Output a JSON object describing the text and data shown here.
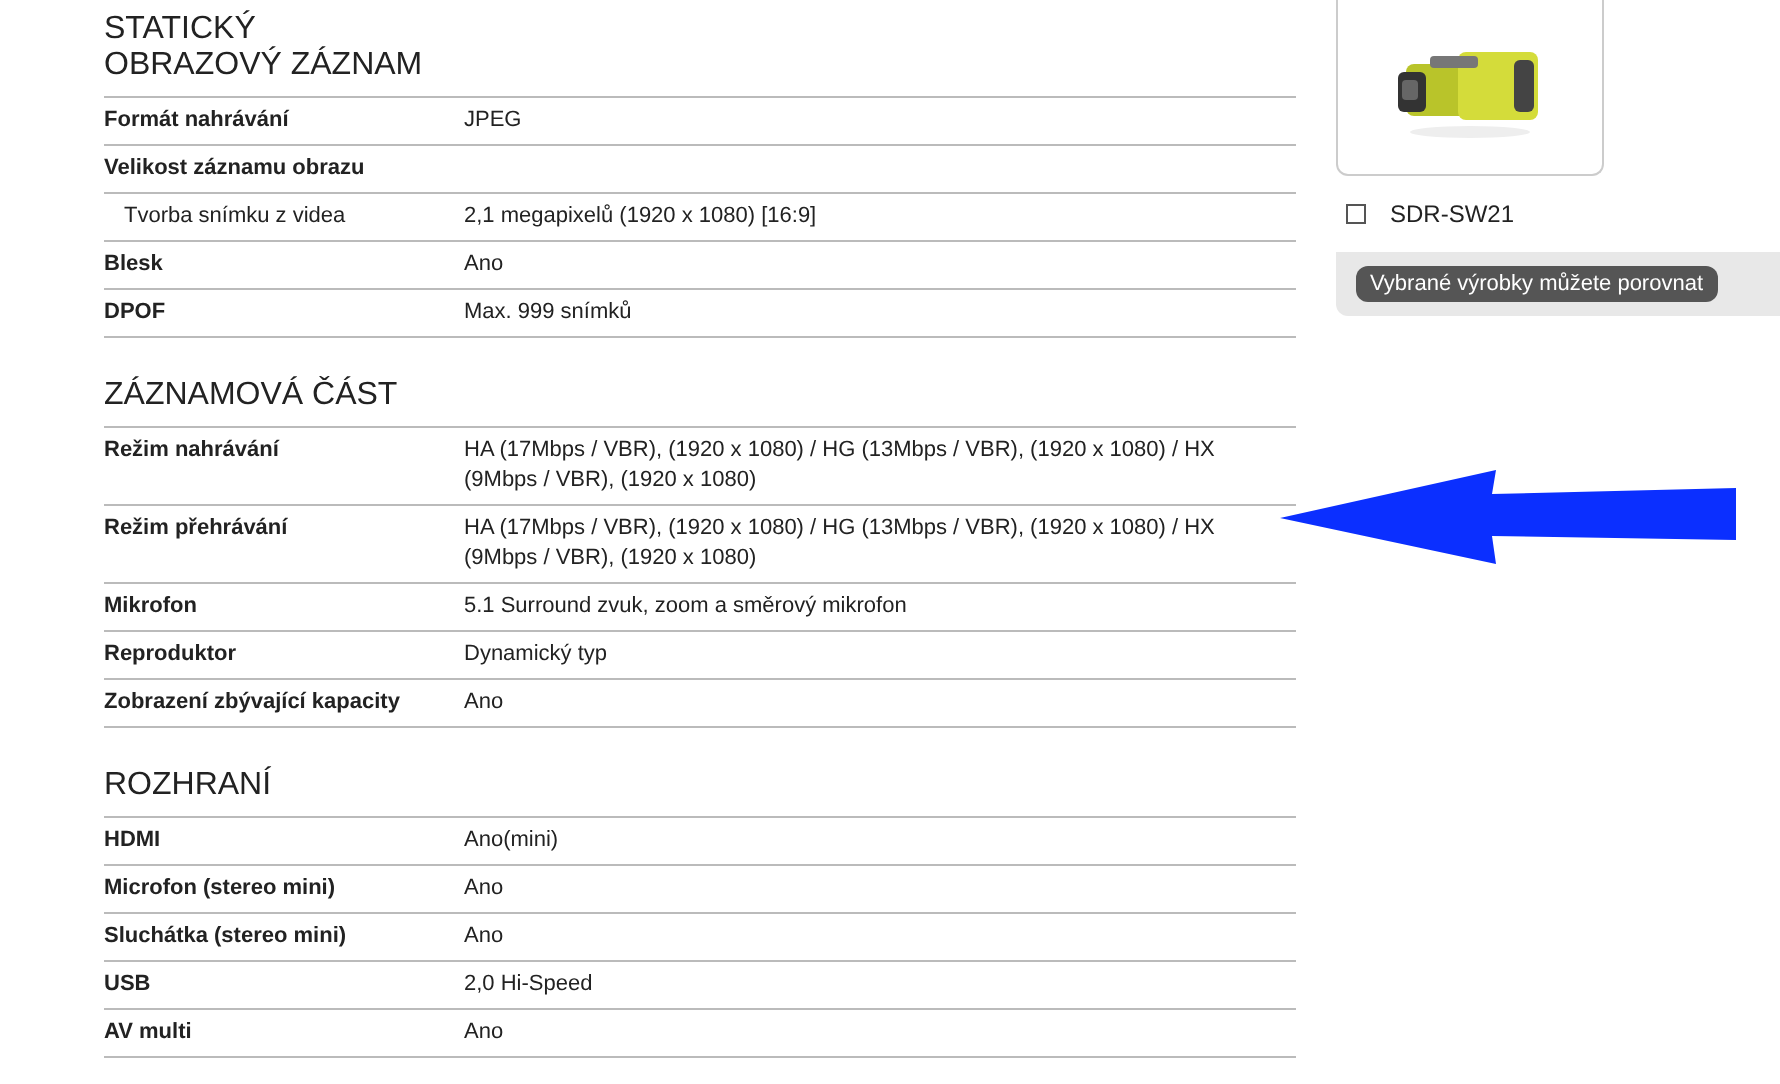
{
  "sections": [
    {
      "title": "STATICKÝ\nOBRAZOVÝ ZÁZNAM",
      "rows": [
        {
          "kind": "main",
          "label": "Formát nahrávání",
          "value": "JPEG"
        },
        {
          "kind": "main",
          "label": "Velikost záznamu obrazu"
        },
        {
          "kind": "sub",
          "label": "Tvorba snímku z videa",
          "value": "2,1 megapixelů (1920 x 1080) [16:9]"
        },
        {
          "kind": "main",
          "label": "Blesk",
          "value": "Ano"
        },
        {
          "kind": "main",
          "label": "DPOF",
          "value": "Max. 999 snímků"
        }
      ]
    },
    {
      "title": "ZÁZNAMOVÁ ČÁST",
      "rows": [
        {
          "kind": "main",
          "label": "Režim nahrávání",
          "value": "HA (17Mbps / VBR), (1920 x 1080) / HG (13Mbps / VBR), (1920 x 1080) / HX (9Mbps / VBR), (1920 x 1080)"
        },
        {
          "kind": "main",
          "label": "Režim přehrávání",
          "value": "HA (17Mbps / VBR), (1920 x 1080) / HG (13Mbps / VBR), (1920 x 1080) / HX (9Mbps / VBR), (1920 x 1080)"
        },
        {
          "kind": "main",
          "label": "Mikrofon",
          "value": "5.1 Surround zvuk, zoom a směrový mikrofon"
        },
        {
          "kind": "main",
          "label": "Reproduktor",
          "value": "Dynamický typ"
        },
        {
          "kind": "main",
          "label": "Zobrazení zbývající kapacity",
          "value": "Ano"
        }
      ]
    },
    {
      "title": "ROZHRANÍ",
      "rows": [
        {
          "kind": "main",
          "label": "HDMI",
          "value": "Ano(mini)"
        },
        {
          "kind": "main",
          "label": "Microfon (stereo mini)",
          "value": "Ano"
        },
        {
          "kind": "main",
          "label": "Sluchátka (stereo mini)",
          "value": "Ano"
        },
        {
          "kind": "main",
          "label": "USB",
          "value": "2,0 Hi-Speed"
        },
        {
          "kind": "main",
          "label": "AV multi",
          "value": "Ano"
        }
      ]
    }
  ],
  "product": {
    "name": "SDR-SW21",
    "checked": false
  },
  "compare_button": "Vybrané výrobky můžete porovnat"
}
